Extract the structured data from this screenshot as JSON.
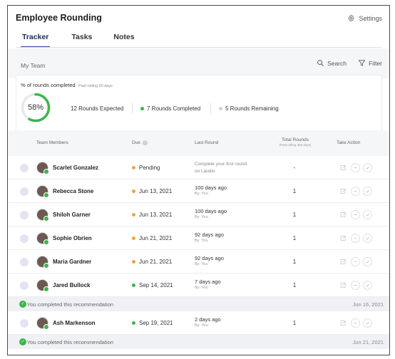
{
  "app": {
    "title": "Employee Rounding",
    "settings_label": "Settings"
  },
  "tabs": [
    {
      "label": "Tracker",
      "active": true
    },
    {
      "label": "Tasks",
      "active": false
    },
    {
      "label": "Notes",
      "active": false
    }
  ],
  "team_bar": {
    "label": "My Team",
    "search_label": "Search",
    "filter_label": "Filter"
  },
  "summary": {
    "title": "% of rounds completed",
    "subtitle": "Past rolling 90 days",
    "percent_label": "58%",
    "percent_value": 58,
    "expected": "12 Rounds Expected",
    "completed": "7 Rounds Completed",
    "remaining": "5 Rounds Remaining"
  },
  "colors": {
    "completed": "#3cb64a",
    "pending": "#f2a33a",
    "remaining": "#cfd3da",
    "accent": "#2f4aa0"
  },
  "table": {
    "headers": {
      "members": "Team Members",
      "due": "Due",
      "last": "Last Round",
      "total": "Total Rounds",
      "total_sub": "(Past rolling 365 days)",
      "action": "Take Action"
    },
    "rows": [
      {
        "name": "Scarlet Gonzalez",
        "due": "Pending",
        "status": "pending",
        "last_main": "Complete your first round",
        "last_sub": "on Laudio",
        "total": "-",
        "pending": true
      },
      {
        "name": "Rebecca Stone",
        "due": "Jun 13, 2021",
        "status": "pending",
        "last_main": "100 days ago",
        "last_sub": "By: You",
        "total": "1"
      },
      {
        "name": "Shiloh Garner",
        "due": "Jun 13, 2021",
        "status": "pending",
        "last_main": "100 days ago",
        "last_sub": "By: You",
        "total": "1"
      },
      {
        "name": "Sophie Obrien",
        "due": "Jun 21, 2021",
        "status": "pending",
        "last_main": "92 days ago",
        "last_sub": "By: You",
        "total": "1"
      },
      {
        "name": "Maria Gardner",
        "due": "Jun 21, 2021",
        "status": "pending",
        "last_main": "92 days ago",
        "last_sub": "By: You",
        "total": "1"
      },
      {
        "name": "Jared Bullock",
        "due": "Sep 14, 2021",
        "status": "completed",
        "last_main": "7 days ago",
        "last_sub": "By: You",
        "total": "1"
      },
      {
        "name": "Ash Markenson",
        "due": "Sep 19, 2021",
        "status": "completed",
        "last_main": "2 days ago",
        "last_sub": "By: You",
        "total": "1"
      }
    ],
    "banners": [
      {
        "text": "You completed this recommendation",
        "date": "Jun 16, 2021"
      },
      {
        "text": "You completed this recommendation",
        "date": "Jun 21, 2021"
      }
    ]
  }
}
